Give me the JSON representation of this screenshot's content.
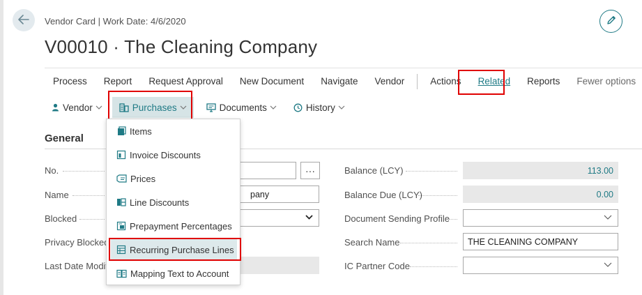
{
  "header": {
    "breadcrumb": "Vendor Card | Work Date: 4/6/2020",
    "title": "V00010 · The Cleaning Company",
    "back_icon": "arrow-left-icon",
    "edit_icon": "pencil-icon"
  },
  "action_bar": {
    "items": [
      "Process",
      "Report",
      "Request Approval",
      "New Document",
      "Navigate",
      "Vendor"
    ],
    "actions": "Actions",
    "related": "Related",
    "reports": "Reports",
    "fewer_options": "Fewer options"
  },
  "sub_bar": {
    "vendor": "Vendor",
    "purchases": "Purchases",
    "documents": "Documents",
    "history": "History"
  },
  "purchases_menu": {
    "items": [
      "Items",
      "Invoice Discounts",
      "Prices",
      "Line Discounts",
      "Prepayment Percentages",
      "Recurring Purchase Lines",
      "Mapping Text to Account"
    ],
    "highlighted": "Recurring Purchase Lines"
  },
  "general": {
    "title": "General",
    "left": {
      "no_label": "No.",
      "name_label": "Name",
      "name_value_partial": "pany",
      "blocked_label": "Blocked",
      "privacy_blocked_label": "Privacy Blocked",
      "last_date_modified_label": "Last Date Modifie"
    },
    "right": {
      "balance_lcy_label": "Balance (LCY)",
      "balance_lcy_value": "113.00",
      "balance_due_lcy_label": "Balance Due (LCY)",
      "balance_due_lcy_value": "0.00",
      "doc_sending_profile_label": "Document Sending Profile",
      "search_name_label": "Search Name",
      "search_name_value": "THE CLEANING COMPANY",
      "ic_partner_code_label": "IC Partner Code"
    }
  },
  "colors": {
    "accent": "#1f7a85",
    "highlight_box": "#e00000"
  }
}
